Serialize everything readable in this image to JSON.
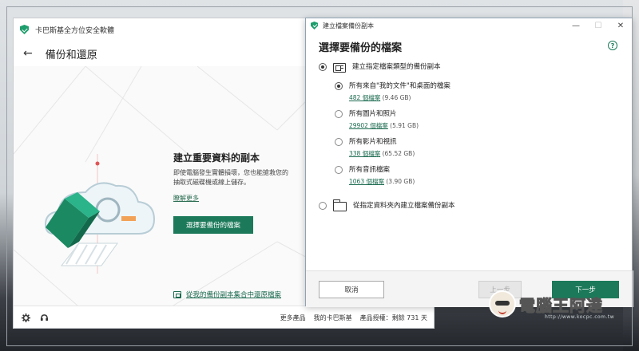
{
  "main_window": {
    "title": "卡巴斯基全方位安全軟體",
    "header_title": "備份和還原",
    "promo": {
      "title": "建立重要資料的副本",
      "description_line1": "即使電腦發生實體損壞，您也能搶救您的",
      "description_line2": "抽取式磁碟機或線上儲存。",
      "learn_more": "瞭解更多",
      "select_button": "選擇要備份的檔案"
    },
    "restore_link": "從我的備份副本集合中還原檔案",
    "footer": {
      "more_products": "更多產品",
      "my_kaspersky": "我的卡巴斯基",
      "license": "產品授權：剩餘 731 天"
    }
  },
  "dialog": {
    "title": "建立檔案備份副本",
    "heading": "選擇要備份的檔案",
    "option_type": "建立指定檔案類型的備份副本",
    "sub_options": [
      {
        "label": "所有來自\"我的文件\"和桌面的檔案",
        "count": "482 個檔案",
        "size": "(9.46 GB)",
        "checked": true
      },
      {
        "label": "所有圖片和照片",
        "count": "29902 個檔案",
        "size": "(5.91 GB)",
        "checked": false
      },
      {
        "label": "所有影片和視訊",
        "count": "338 個檔案",
        "size": "(65.52 GB)",
        "checked": false
      },
      {
        "label": "所有音訊檔案",
        "count": "1063 個檔案",
        "size": "(3.90 GB)",
        "checked": false
      }
    ],
    "option_folder": "從指定資料夾內建立檔案備份副本",
    "buttons": {
      "cancel": "取消",
      "previous": "上一步",
      "next": "下一步"
    }
  },
  "watermark": {
    "text": "電腦王阿達",
    "url": "http://www.kocpc.com.tw"
  },
  "colors": {
    "accent": "#1c7a5a",
    "link": "#1c6b50"
  }
}
